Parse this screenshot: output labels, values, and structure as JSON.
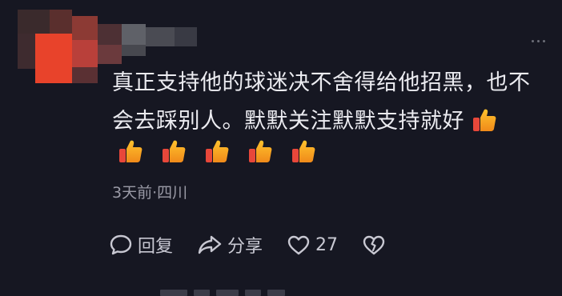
{
  "comment": {
    "text_line1": "真正支持他的球迷决不舍得给他招黑，也不",
    "text_line2": "会去踩别人。默默关注默默支持就好",
    "emoji_icon": "thumbs-up-icon",
    "emoji_count_row": 5,
    "meta": "3天前·四川"
  },
  "actions": {
    "reply_label": "回复",
    "share_label": "分享",
    "like_count": "27"
  },
  "colors": {
    "background": "#161722",
    "text": "#ececf1",
    "muted": "#9a9aa6",
    "thumb_orange": "#f5a623",
    "thumb_red": "#e8473a"
  }
}
